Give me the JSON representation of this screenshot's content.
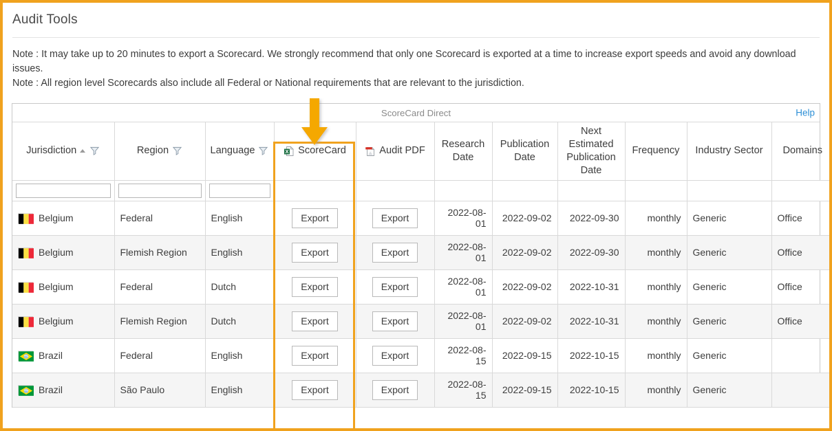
{
  "page": {
    "title": "Audit Tools",
    "accent_color": "#F0A21E",
    "link_color": "#2c8fd6"
  },
  "notes": [
    "Note : It may take up to 20 minutes to export a Scorecard. We strongly recommend that only one Scorecard is exported at a time to increase export speeds and avoid any download issues.",
    "Note : All region level Scorecards also include all Federal or National requirements that are relevant to the jurisdiction."
  ],
  "grid": {
    "toolbar_title": "ScoreCard Direct",
    "help_label": "Help",
    "columns": [
      {
        "key": "jurisdiction",
        "label": "Jurisdiction",
        "sort": "asc",
        "filter_icon": true
      },
      {
        "key": "region",
        "label": "Region",
        "filter_icon": true
      },
      {
        "key": "language",
        "label": "Language",
        "filter_icon": true
      },
      {
        "key": "scorecard",
        "label": "ScoreCard",
        "icon": "excel-icon"
      },
      {
        "key": "audit_pdf",
        "label": "Audit PDF",
        "icon": "pdf-icon"
      },
      {
        "key": "research_date",
        "label": "Research Date"
      },
      {
        "key": "publication_date",
        "label": "Publication Date"
      },
      {
        "key": "next_estimated_publication_date",
        "label": "Next Estimated Publication Date"
      },
      {
        "key": "frequency",
        "label": "Frequency"
      },
      {
        "key": "industry_sector",
        "label": "Industry Sector"
      },
      {
        "key": "domains",
        "label": "Domains"
      }
    ],
    "filters": [
      {
        "key": "jurisdiction",
        "value": "",
        "placeholder": ""
      },
      {
        "key": "region",
        "value": "",
        "placeholder": ""
      },
      {
        "key": "language",
        "value": "",
        "placeholder": ""
      }
    ],
    "export_label": "Export",
    "rows": [
      {
        "flag": "belgium-flag",
        "jurisdiction": "Belgium",
        "region": "Federal",
        "language": "English",
        "scorecard": "Export",
        "audit_pdf": "Export",
        "research_date": "2022-08-01",
        "publication_date": "2022-09-02",
        "next_estimated_publication_date": "2022-09-30",
        "frequency": "monthly",
        "industry_sector": "Generic",
        "domains": "Office"
      },
      {
        "flag": "belgium-flag",
        "jurisdiction": "Belgium",
        "region": "Flemish Region",
        "language": "English",
        "scorecard": "Export",
        "audit_pdf": "Export",
        "research_date": "2022-08-01",
        "publication_date": "2022-09-02",
        "next_estimated_publication_date": "2022-09-30",
        "frequency": "monthly",
        "industry_sector": "Generic",
        "domains": "Office"
      },
      {
        "flag": "belgium-flag",
        "jurisdiction": "Belgium",
        "region": "Federal",
        "language": "Dutch",
        "scorecard": "Export",
        "audit_pdf": "Export",
        "research_date": "2022-08-01",
        "publication_date": "2022-09-02",
        "next_estimated_publication_date": "2022-10-31",
        "frequency": "monthly",
        "industry_sector": "Generic",
        "domains": "Office"
      },
      {
        "flag": "belgium-flag",
        "jurisdiction": "Belgium",
        "region": "Flemish Region",
        "language": "Dutch",
        "scorecard": "Export",
        "audit_pdf": "Export",
        "research_date": "2022-08-01",
        "publication_date": "2022-09-02",
        "next_estimated_publication_date": "2022-10-31",
        "frequency": "monthly",
        "industry_sector": "Generic",
        "domains": "Office"
      },
      {
        "flag": "brazil-flag",
        "jurisdiction": "Brazil",
        "region": "Federal",
        "language": "English",
        "scorecard": "Export",
        "audit_pdf": "Export",
        "research_date": "2022-08-15",
        "publication_date": "2022-09-15",
        "next_estimated_publication_date": "2022-10-15",
        "frequency": "monthly",
        "industry_sector": "Generic",
        "domains": ""
      },
      {
        "flag": "brazil-flag",
        "jurisdiction": "Brazil",
        "region": "São Paulo",
        "language": "English",
        "scorecard": "Export",
        "audit_pdf": "Export",
        "research_date": "2022-08-15",
        "publication_date": "2022-09-15",
        "next_estimated_publication_date": "2022-10-15",
        "frequency": "monthly",
        "industry_sector": "Generic",
        "domains": ""
      }
    ]
  },
  "annotations": {
    "arrow": "down-arrow-annotation",
    "column_highlight": "scorecard-column-highlight"
  }
}
